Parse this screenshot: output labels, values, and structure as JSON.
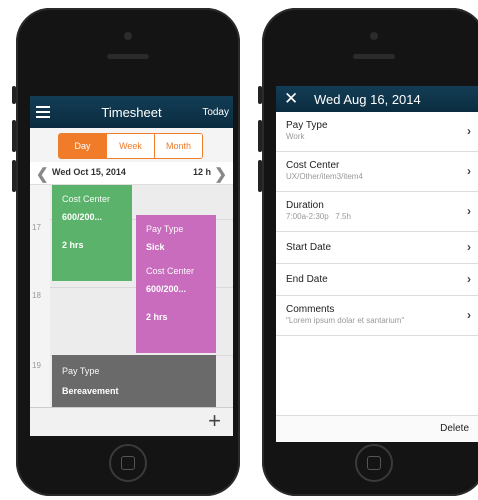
{
  "left": {
    "header": {
      "title": "Timesheet",
      "today_label": "Today"
    },
    "tabs": [
      "Day",
      "Week",
      "Month"
    ],
    "datebar": {
      "date": "Wed Oct 15, 2014",
      "hours": "12 h"
    },
    "hour_labels": [
      "17",
      "18",
      "19"
    ],
    "events": {
      "green": {
        "label": "Cost Center",
        "value": "600/200...",
        "duration": "2 hrs",
        "color": "#5bb36b"
      },
      "pink": {
        "pay_label": "Pay Type",
        "pay_value": "Sick",
        "cc_label": "Cost Center",
        "cc_value": "600/200...",
        "duration": "2 hrs",
        "color": "#c96cbd"
      },
      "gray": {
        "label": "Pay Type",
        "value": "Bereavement",
        "color": "#6a6a6a"
      }
    }
  },
  "right": {
    "header": {
      "title": "Wed Aug 16, 2014"
    },
    "rows": [
      {
        "label": "Pay Type",
        "value": "Work"
      },
      {
        "label": "Cost Center",
        "value": "UX/Other/item3/item4"
      },
      {
        "label": "Duration",
        "value": "7:00a-2:30p   7.5h"
      },
      {
        "label": "Start Date",
        "value": ""
      },
      {
        "label": "End Date",
        "value": ""
      },
      {
        "label": "Comments",
        "value": "\"Lorem ipsum dolar et santarium\""
      }
    ],
    "footer": {
      "delete_label": "Delete"
    }
  },
  "colors": {
    "accent": "#f07c2a",
    "navbar": "#0e3a52"
  },
  "icons": [
    "menu-icon",
    "chevron-left-icon",
    "chevron-right-icon",
    "plus-icon",
    "close-icon",
    "chevron-right-icon"
  ]
}
